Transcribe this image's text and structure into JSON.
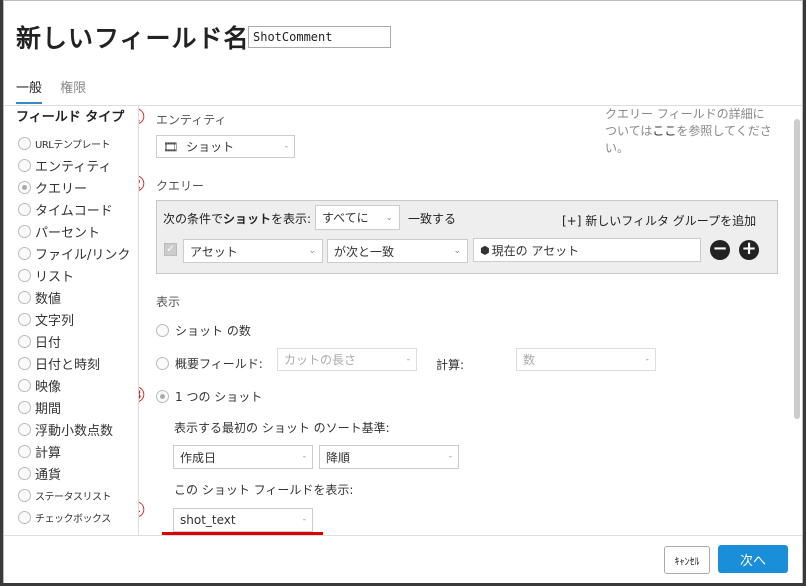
{
  "header": {
    "title": "新しいフィールド名",
    "field_name_value": "ShotComment"
  },
  "tabs": [
    {
      "label": "一般"
    },
    {
      "label": "権限"
    }
  ],
  "sidebar": {
    "title": "フィールド タイプ",
    "items": [
      {
        "label": "URLテンプレート",
        "selected": false
      },
      {
        "label": "エンティティ",
        "selected": false
      },
      {
        "label": "クエリー",
        "selected": true
      },
      {
        "label": "タイムコード",
        "selected": false
      },
      {
        "label": "パーセント",
        "selected": false
      },
      {
        "label": "ファイル/リンク",
        "selected": false
      },
      {
        "label": "リスト",
        "selected": false
      },
      {
        "label": "数値",
        "selected": false
      },
      {
        "label": "文字列",
        "selected": false
      },
      {
        "label": "日付",
        "selected": false
      },
      {
        "label": "日付と時刻",
        "selected": false
      },
      {
        "label": "映像",
        "selected": false
      },
      {
        "label": "期間",
        "selected": false
      },
      {
        "label": "浮動小数点数",
        "selected": false
      },
      {
        "label": "計算",
        "selected": false
      },
      {
        "label": "通貨",
        "selected": false
      },
      {
        "label": "ステータスリスト",
        "selected": false
      },
      {
        "label": "チェックボックス",
        "selected": false
      }
    ]
  },
  "annotations": [
    "①",
    "②",
    "③",
    "④"
  ],
  "entity": {
    "label": "エンティティ",
    "value": "ショット",
    "icon": "film-icon"
  },
  "info_text_1": "クエリー フィールドの詳細に",
  "info_text_2a": "ついては",
  "info_link": "ここ",
  "info_text_2b": "を参照してくださ",
  "info_text_3": "い。",
  "query": {
    "label": "クエリー",
    "prefix": "次の条件で",
    "prefix_bold": "ショット",
    "prefix_end": "を表示:",
    "match_value": "すべてに",
    "match_suffix": "一致する",
    "add_group": "[+] 新しいフィルタ グループを追加",
    "filter_field": "アセット",
    "filter_operator": "が次と一致",
    "filter_value": "現在の アセット"
  },
  "display": {
    "label": "表示",
    "opt_count": "ショット の数",
    "opt_summary": "概要フィールド:",
    "summary_field_placeholder": "カットの長さ",
    "calc_label": "計算:",
    "calc_placeholder": "数",
    "opt_single": "1 つの ショット",
    "sort_label": "表示する最初の ショット のソート基準:",
    "sort_field": "作成日",
    "sort_order": "降順",
    "show_field_label": "この ショット フィールドを表示:",
    "show_field_value": "shot_text"
  },
  "footer": {
    "cancel": "ｷｬﾝｾﾙ",
    "next": "次へ"
  },
  "colors": {
    "accent": "#1b8ed9",
    "annotation": "#e01010"
  }
}
